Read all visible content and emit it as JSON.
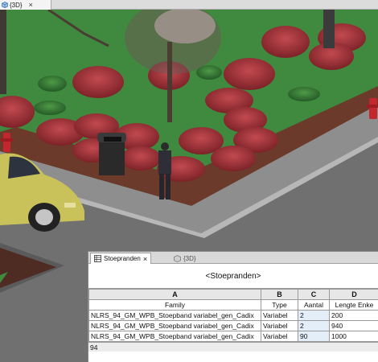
{
  "view_tab": {
    "label": "{3D}"
  },
  "schedule": {
    "tabs": [
      {
        "label": "Stoepranden",
        "active": true
      },
      {
        "label": "{3D}",
        "active": false
      }
    ],
    "title": "<Stoepranden>",
    "column_letters": [
      "A",
      "B",
      "C",
      "D"
    ],
    "headers": [
      "Family",
      "Type",
      "Aantal",
      "Lengte Enke"
    ],
    "rows": [
      [
        "NLRS_94_GM_WPB_Stoepband variabel_gen_Cadix",
        "Variabel",
        "2",
        "200"
      ],
      [
        "NLRS_94_GM_WPB_Stoepband variabel_gen_Cadix",
        "Variabel",
        "2",
        "940"
      ],
      [
        "NLRS_94_GM_WPB_Stoepband variabel_gen_Cadix",
        "Variabel",
        "90",
        "1000"
      ]
    ],
    "status_value": "94"
  },
  "colors": {
    "grass": "#3f8a3e",
    "mulch": "#6b3a2a",
    "sidewalk": "#8e8e8e",
    "road": "#6a6a6a",
    "car": "#c9c25a",
    "shrub": "#a8333d"
  }
}
